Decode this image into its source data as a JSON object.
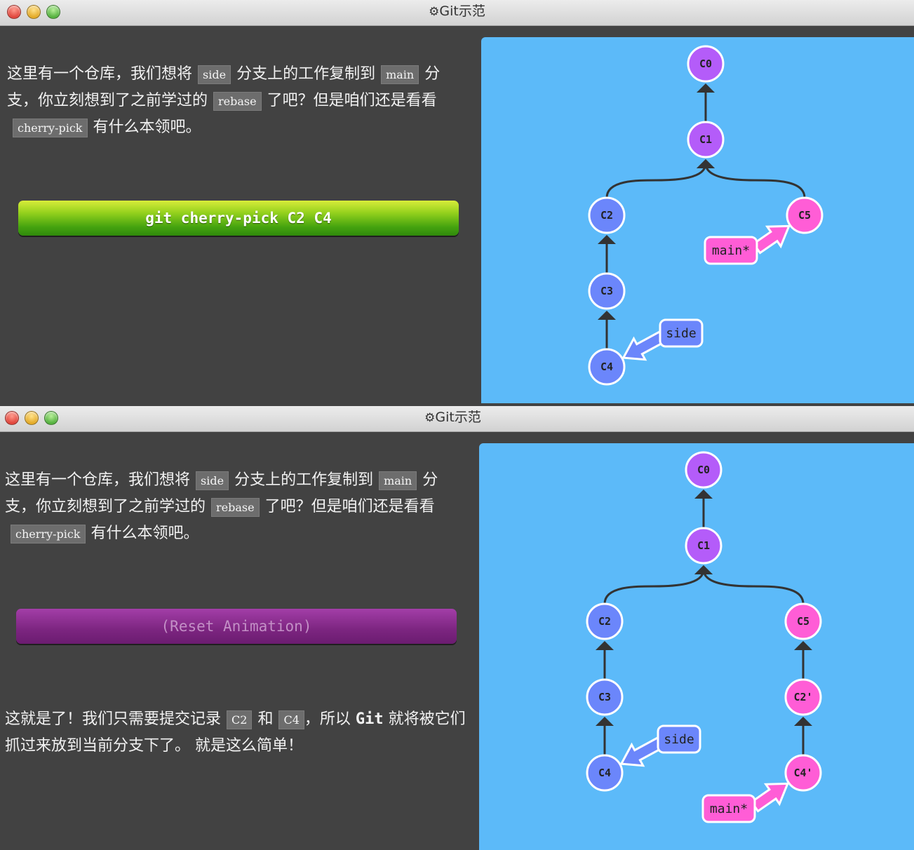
{
  "app_title": "Git示范",
  "colors": {
    "viz_background": "#5cbaf9",
    "main_branch": "#ff5dd6",
    "side_branch": "#6b86fb",
    "base_commits": "#b45cf9",
    "run_button": "#6bc514",
    "reset_button": "#8c2f91"
  },
  "icons": {
    "settings": "gear-icon"
  },
  "intro": {
    "t1": "这里有一个仓库，我们想将",
    "c1": "side",
    "t2": "分支上的工作复制到",
    "c2": "main",
    "t3": "分支，你立刻想到了之前学过的",
    "c3": "rebase",
    "t4": "了吧？但是咱们还是看看",
    "c4": "cherry-pick",
    "t5": "有什么本领吧。"
  },
  "command_button": {
    "label": "git cherry-pick C2 C4"
  },
  "reset_button": {
    "label": "(Reset Animation)"
  },
  "outro": {
    "t1": "这就是了！我们只需要提交记录",
    "c1": "C2",
    "t2": "和",
    "c2": "C4",
    "t3": "，所以",
    "b1": "Git",
    "t4": "就将被它们抓过来放到当前分支下了。 就是这么简单！"
  },
  "before_graph": {
    "commits": [
      {
        "id": "C0",
        "branch": "base"
      },
      {
        "id": "C1",
        "branch": "base"
      },
      {
        "id": "C2",
        "branch": "side"
      },
      {
        "id": "C3",
        "branch": "side"
      },
      {
        "id": "C4",
        "branch": "side"
      },
      {
        "id": "C5",
        "branch": "main"
      }
    ],
    "edges": [
      [
        "C1",
        "C0"
      ],
      [
        "C2",
        "C1"
      ],
      [
        "C5",
        "C1"
      ],
      [
        "C3",
        "C2"
      ],
      [
        "C4",
        "C3"
      ]
    ],
    "branches": [
      {
        "label": "main*",
        "target": "C5",
        "color": "main"
      },
      {
        "label": "side",
        "target": "C4",
        "color": "side"
      }
    ]
  },
  "after_graph": {
    "commits": [
      {
        "id": "C0",
        "branch": "base"
      },
      {
        "id": "C1",
        "branch": "base"
      },
      {
        "id": "C2",
        "branch": "side"
      },
      {
        "id": "C3",
        "branch": "side"
      },
      {
        "id": "C4",
        "branch": "side"
      },
      {
        "id": "C5",
        "branch": "main"
      },
      {
        "id": "C2'",
        "branch": "main"
      },
      {
        "id": "C4'",
        "branch": "main"
      }
    ],
    "edges": [
      [
        "C1",
        "C0"
      ],
      [
        "C2",
        "C1"
      ],
      [
        "C5",
        "C1"
      ],
      [
        "C3",
        "C2"
      ],
      [
        "C4",
        "C3"
      ],
      [
        "C2'",
        "C5"
      ],
      [
        "C4'",
        "C2'"
      ]
    ],
    "branches": [
      {
        "label": "main*",
        "target": "C4'",
        "color": "main"
      },
      {
        "label": "side",
        "target": "C4",
        "color": "side"
      }
    ]
  }
}
